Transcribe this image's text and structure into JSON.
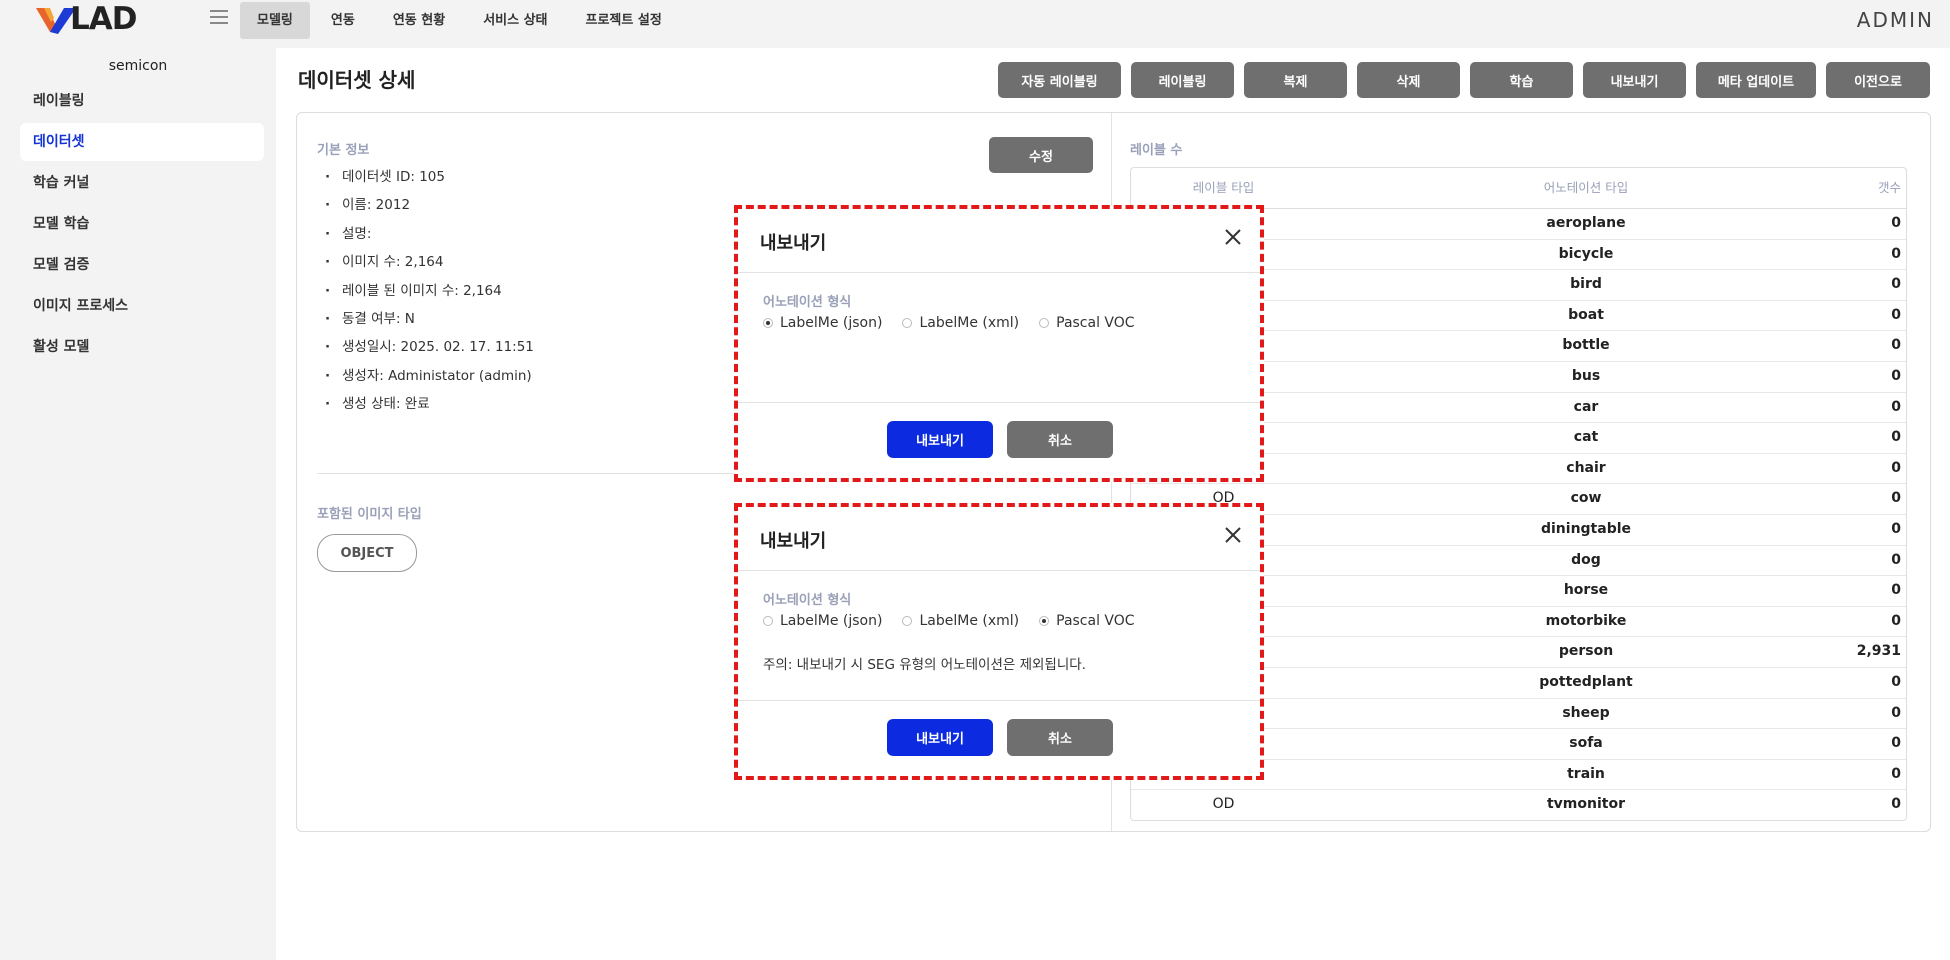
{
  "app": {
    "logo_text": "LAD",
    "user": "ADMIN"
  },
  "topmenu": [
    {
      "label": "모델링"
    },
    {
      "label": "연동"
    },
    {
      "label": "연동 현황"
    },
    {
      "label": "서비스 상태"
    },
    {
      "label": "프로젝트 설정"
    }
  ],
  "sidebar": {
    "project": "semicon",
    "items": [
      {
        "label": "레이블링"
      },
      {
        "label": "데이터셋"
      },
      {
        "label": "학습 커널"
      },
      {
        "label": "모델 학습"
      },
      {
        "label": "모델 검증"
      },
      {
        "label": "이미지 프로세스"
      },
      {
        "label": "활성 모델"
      }
    ]
  },
  "page": {
    "title": "데이터셋 상세"
  },
  "actions": [
    "자동 레이블링",
    "레이블링",
    "복제",
    "삭제",
    "학습",
    "내보내기",
    "메타 업데이트",
    "이전으로"
  ],
  "basic_info": {
    "title": "기본 정보",
    "edit_label": "수정",
    "rows": [
      "데이터셋 ID: 105",
      "이름: 2012",
      "설명:",
      "이미지 수: 2,164",
      "레이블 된 이미지 수: 2,164",
      "동결 여부: N",
      "생성일시: 2025. 02. 17. 11:51",
      "생성자: Administator (admin)",
      "생성 상태: 완료"
    ]
  },
  "image_types": {
    "title": "포함된 이미지 타입",
    "items": [
      "OBJECT"
    ]
  },
  "label_counts": {
    "title": "레이블 수",
    "headers": [
      "레이블 타입",
      "어노테이션 타입",
      "갯수"
    ],
    "rows": [
      {
        "type": "",
        "name": "aeroplane",
        "count": "0"
      },
      {
        "type": "",
        "name": "bicycle",
        "count": "0"
      },
      {
        "type": "",
        "name": "bird",
        "count": "0"
      },
      {
        "type": "",
        "name": "boat",
        "count": "0"
      },
      {
        "type": "",
        "name": "bottle",
        "count": "0"
      },
      {
        "type": "",
        "name": "bus",
        "count": "0"
      },
      {
        "type": "",
        "name": "car",
        "count": "0"
      },
      {
        "type": "",
        "name": "cat",
        "count": "0"
      },
      {
        "type": "",
        "name": "chair",
        "count": "0"
      },
      {
        "type": "OD",
        "name": "cow",
        "count": "0"
      },
      {
        "type": "",
        "name": "diningtable",
        "count": "0"
      },
      {
        "type": "",
        "name": "dog",
        "count": "0"
      },
      {
        "type": "",
        "name": "horse",
        "count": "0"
      },
      {
        "type": "",
        "name": "motorbike",
        "count": "0"
      },
      {
        "type": "",
        "name": "person",
        "count": "2,931"
      },
      {
        "type": "",
        "name": "pottedplant",
        "count": "0"
      },
      {
        "type": "",
        "name": "sheep",
        "count": "0"
      },
      {
        "type": "",
        "name": "sofa",
        "count": "0"
      },
      {
        "type": "",
        "name": "train",
        "count": "0"
      },
      {
        "type": "OD",
        "name": "tvmonitor",
        "count": "0"
      }
    ]
  },
  "modal1": {
    "title": "내보내기",
    "format_label": "어노테이션 형식",
    "options": [
      "LabelMe (json)",
      "LabelMe (xml)",
      "Pascal VOC"
    ],
    "selected": "LabelMe (json)",
    "note": "",
    "confirm": "내보내기",
    "cancel": "취소"
  },
  "modal2": {
    "title": "내보내기",
    "format_label": "어노테이션 형식",
    "options": [
      "LabelMe (json)",
      "LabelMe (xml)",
      "Pascal VOC"
    ],
    "selected": "Pascal VOC",
    "note": "주의: 내보내기 시 SEG 유형의 어노테이션은 제외됩니다.",
    "confirm": "내보내기",
    "cancel": "취소"
  },
  "colors": {
    "accent_blue": "#0c2be0",
    "highlight_red": "#e11919",
    "button_gray": "#6f6f6f",
    "label_gray": "#9aa0b8"
  }
}
